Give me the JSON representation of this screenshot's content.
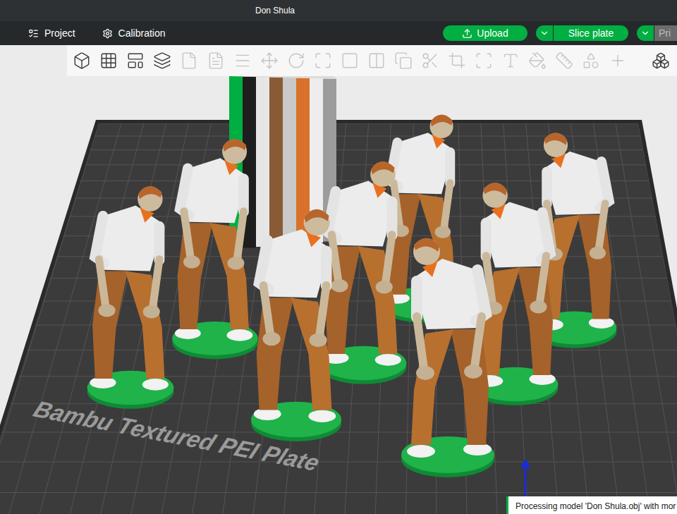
{
  "window": {
    "title": "Don Shula"
  },
  "nav": [
    {
      "label": "Project",
      "selected": false
    },
    {
      "label": "Calibration",
      "selected": false
    }
  ],
  "actions": [
    {
      "label": "Upload",
      "kind": "button",
      "disabled": false
    },
    {
      "label": "Slice plate",
      "kind": "split",
      "disabled": false
    },
    {
      "label": "Pri",
      "kind": "split",
      "disabled": true
    }
  ],
  "toolbar": [
    {
      "disabled": false
    },
    {
      "disabled": false
    },
    {
      "disabled": false
    },
    {
      "disabled": false
    },
    {
      "disabled": true
    },
    {
      "disabled": true
    },
    {
      "disabled": true
    },
    {
      "disabled": true
    },
    {
      "disabled": true
    },
    {
      "disabled": true
    },
    {
      "disabled": true
    },
    {
      "disabled": true
    },
    {
      "disabled": true
    },
    {
      "disabled": true
    },
    {
      "disabled": true
    },
    {
      "disabled": true
    },
    {
      "disabled": true
    },
    {
      "disabled": true
    },
    {
      "disabled": true
    },
    {
      "disabled": true
    },
    {
      "disabled": true
    },
    {
      "disabled": false
    }
  ],
  "plate": {
    "label": "Bambu Textured PEI Plate"
  },
  "notification": {
    "text": "Processing model 'Don Shula.obj' with mor"
  }
}
